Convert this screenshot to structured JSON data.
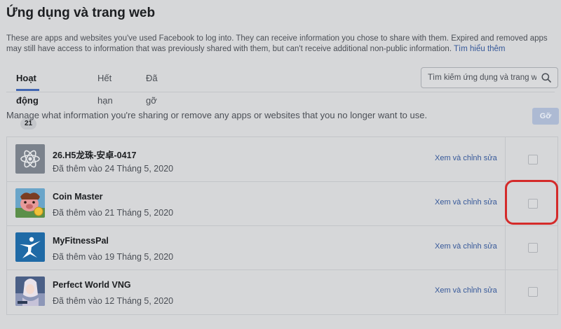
{
  "page": {
    "title": "Ứng dụng và trang web",
    "description": "These are apps and websites you've used Facebook to log into. They can receive information you chose to share with them. Expired and removed apps may still have access to information that was previously shared with them, but can't receive additional non-public information.",
    "learn_more": "Tìm hiểu thêm",
    "manage_text": "Manage what information you're sharing or remove any apps or websites that you no longer want to use.",
    "remove_button": "Gỡ"
  },
  "tabs": [
    {
      "label": "Hoạt động",
      "count": "21",
      "active": true
    },
    {
      "label": "Hết hạn",
      "active": false
    },
    {
      "label": "Đã gỡ",
      "active": false
    }
  ],
  "search": {
    "placeholder": "Tìm kiếm ứng dụng và trang web"
  },
  "apps": [
    {
      "name": "26.H5龙珠-安卓-0417",
      "date": "Đã thêm vào 24 Tháng 5, 2020",
      "action": "Xem và chỉnh sửa",
      "icon": "atom-icon",
      "checked": false
    },
    {
      "name": "Coin Master",
      "date": "Đã thêm vào 21 Tháng 5, 2020",
      "action": "Xem và chỉnh sửa",
      "icon": "coin-master-icon",
      "checked": false
    },
    {
      "name": "MyFitnessPal",
      "date": "Đã thêm vào 19 Tháng 5, 2020",
      "action": "Xem và chỉnh sửa",
      "icon": "myfitnesspal-icon",
      "checked": false
    },
    {
      "name": "Perfect World VNG",
      "date": "Đã thêm vào 12 Tháng 5, 2020",
      "action": "Xem và chỉnh sửa",
      "icon": "perfect-world-icon",
      "checked": false
    }
  ],
  "colors": {
    "background": "#d6d7d9",
    "link": "#365899",
    "tab_underline": "#4267b2",
    "highlight": "#d42a2a"
  }
}
